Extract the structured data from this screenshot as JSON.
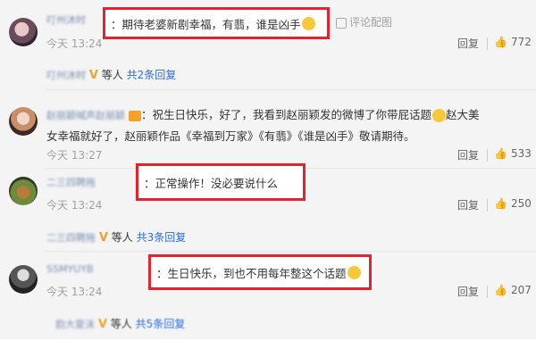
{
  "comments": [
    {
      "username": "叮州沐时",
      "boxed_text": "：期待老婆新剧幸福，有翡，谁是凶手",
      "extra_link": "评论配图",
      "time": "今天 13:24",
      "reply_label": "回复",
      "likes": "772"
    },
    {
      "username": "叮州沐时",
      "others_suffix": "等人",
      "replies_link": "共2条回复"
    },
    {
      "username": "赵丽颖喊声赵丽颖",
      "text_line1": "：祝生日快乐，好了，我看到赵丽颖发的微博了你带屁话题",
      "text_line1_end": "赵大美",
      "text_line2": "女幸福就好了，赵丽颖作品《幸福到万家》《有翡》《谁是凶手》敬请期待。",
      "time": "今天 13:27",
      "reply_label": "回复",
      "likes": "533"
    },
    {
      "username": "二三四聘拖",
      "boxed_text": "：正常操作！没必要说什么",
      "time": "今天 13:24",
      "reply_label": "回复",
      "likes": "250"
    },
    {
      "username": "二三四聘拖",
      "others_suffix": "等人",
      "replies_link": "共3条回复"
    },
    {
      "username": "SSMYUYB",
      "boxed_text": "：生日快乐，到也不用每年整这个话题",
      "time": "今天 13:24",
      "reply_label": "回复",
      "likes": "207"
    },
    {
      "username": "韵大夏沫",
      "others_suffix": "等人",
      "replies_link": "共5条回复"
    }
  ],
  "colors": {
    "accent_link": "#eb7350",
    "reply_link": "#2b6de5",
    "highlight_box": "#e5232e"
  }
}
